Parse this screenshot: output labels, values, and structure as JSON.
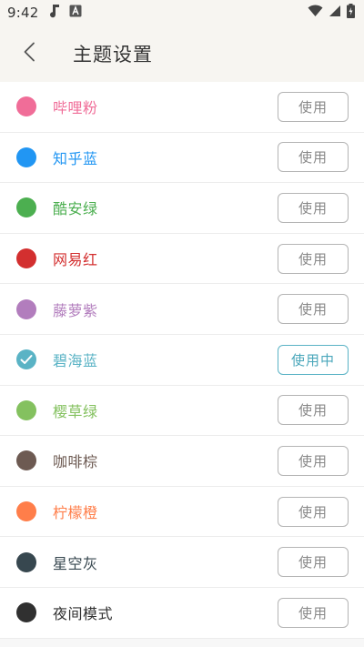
{
  "status_bar": {
    "time": "9:42",
    "icons": [
      "music-note-icon",
      "keyboard-a-icon",
      "wifi-icon",
      "signal-icon",
      "battery-charging-icon"
    ]
  },
  "header": {
    "title": "主题设置",
    "back_icon": "chevron-left-icon"
  },
  "themes": [
    {
      "name": "哔哩粉",
      "color": "#f06d98",
      "button": "使用",
      "active": false
    },
    {
      "name": "知乎蓝",
      "color": "#2196f3",
      "button": "使用",
      "active": false
    },
    {
      "name": "酷安绿",
      "color": "#4caf50",
      "button": "使用",
      "active": false
    },
    {
      "name": "网易红",
      "color": "#d32f2f",
      "button": "使用",
      "active": false
    },
    {
      "name": "藤萝紫",
      "color": "#b27dbd",
      "button": "使用",
      "active": false
    },
    {
      "name": "碧海蓝",
      "color": "#5ab3c5",
      "button": "使用中",
      "active": true
    },
    {
      "name": "樱草绿",
      "color": "#84c15f",
      "button": "使用",
      "active": false
    },
    {
      "name": "咖啡棕",
      "color": "#6d5a52",
      "button": "使用",
      "active": false
    },
    {
      "name": "柠檬橙",
      "color": "#ff7e4a",
      "button": "使用",
      "active": false
    },
    {
      "name": "星空灰",
      "color": "#37474f",
      "button": "使用",
      "active": false
    },
    {
      "name": "夜间模式",
      "color": "#303030",
      "button": "使用",
      "active": false
    }
  ]
}
